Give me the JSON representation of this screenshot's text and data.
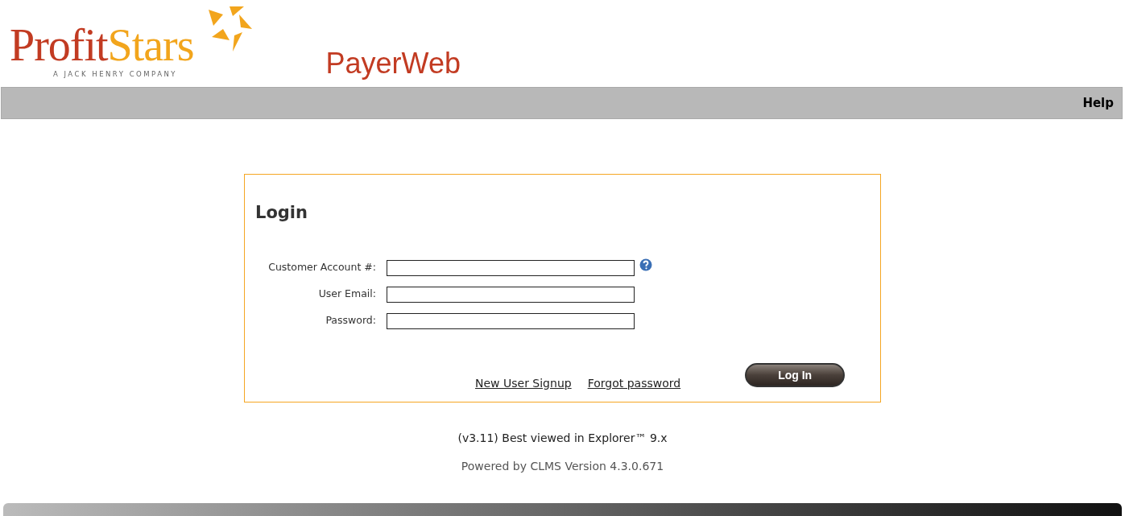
{
  "logo": {
    "word_1": "Profit",
    "word_2": "Stars",
    "tagline": "A JACK HENRY COMPANY"
  },
  "app_name": "PayerWeb",
  "nav": {
    "help": "Help"
  },
  "login": {
    "title": "Login",
    "fields": [
      {
        "label": "Customer Account #:",
        "help": true
      },
      {
        "label": "User Email:",
        "help": false
      },
      {
        "label": "Password:",
        "help": false
      }
    ],
    "links": [
      "New User Signup",
      "Forgot password"
    ],
    "button": "Log In"
  },
  "footer": {
    "version": "(v3.11) Best viewed in Explorer™ 9.x",
    "powered": "Powered by CLMS Version 4.3.0.671"
  }
}
